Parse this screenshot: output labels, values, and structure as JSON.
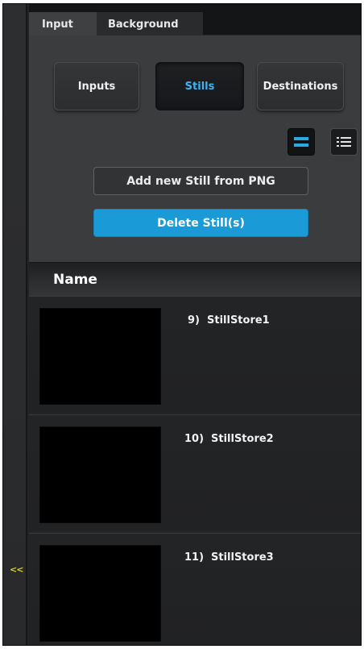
{
  "tabs": [
    {
      "label": "Input",
      "active": true
    },
    {
      "label": "Background",
      "active": false
    }
  ],
  "source_buttons": [
    {
      "label": "Inputs",
      "selected": false
    },
    {
      "label": "Stills",
      "selected": true
    },
    {
      "label": "Destinations",
      "selected": false
    }
  ],
  "view_modes": [
    {
      "icon": "thumbnail-view-icon",
      "active": true
    },
    {
      "icon": "list-view-icon",
      "active": false
    }
  ],
  "actions": {
    "add_label": "Add new Still from PNG",
    "delete_label": "Delete Still(s)"
  },
  "table": {
    "column_name": "Name",
    "rows": [
      {
        "index": "9)",
        "name": "StillStore1"
      },
      {
        "index": "10)",
        "name": "StillStore2"
      },
      {
        "index": "11)",
        "name": "StillStore3"
      }
    ]
  },
  "rail": {
    "collapse_label": "<<"
  },
  "colors": {
    "accent": "#1a9ad6",
    "selected_text": "#3ab4f2",
    "collapse_arrow": "#e0d21a"
  }
}
